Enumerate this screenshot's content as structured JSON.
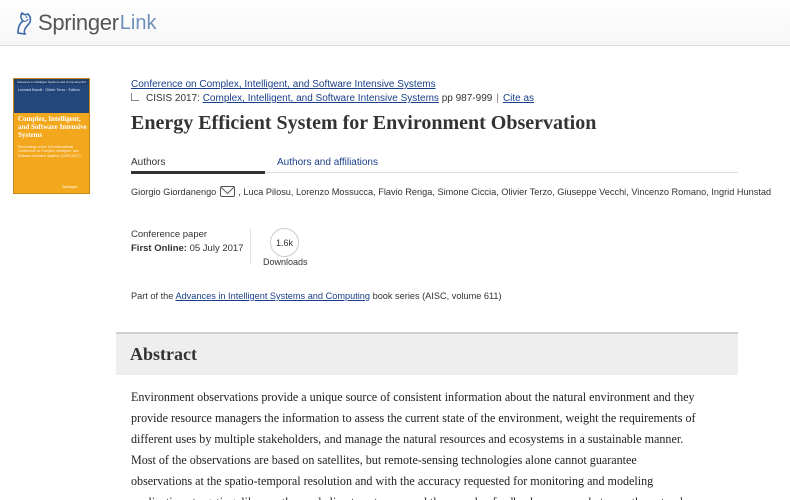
{
  "header": {
    "logo_springer": "Springer",
    "logo_link": "Link"
  },
  "cover": {
    "series": "Advances in Intelligent Systems and Computing 611",
    "editors": "Leonard Barolli · Olivier Terzo · Editors",
    "title": "Complex, Intelligent, and Software Intensive Systems",
    "subtitle": "Proceedings of the 11th International Conference on Complex, Intelligent, and Software Intensive Systems (CISIS-2017)",
    "publisher": "Springer"
  },
  "breadcrumb": {
    "conference": "Conference on Complex, Intelligent, and Software Intensive Systems",
    "proceedings_prefix": "CISIS 2017:",
    "proceedings_link": "Complex, Intelligent, and Software Intensive Systems",
    "pages": "pp 987-999",
    "separator": "|",
    "cite_as": "Cite as"
  },
  "paper": {
    "title": "Energy Efficient System for Environment Observation"
  },
  "tabs": {
    "authors": "Authors",
    "affiliations": "Authors and affiliations"
  },
  "authors": {
    "first": "Giorgio Giordanengo",
    "rest": ", Luca Pilosu, Lorenzo Mossucca, Flavio Renga, Simone Ciccia, Olivier Terzo, Giuseppe Vecchi, Vincenzo Romano, Ingrid Hunstad"
  },
  "meta": {
    "type": "Conference paper",
    "first_online_label": "First Online:",
    "first_online_date": "05 July 2017",
    "downloads_count": "1.6k",
    "downloads_label": "Downloads"
  },
  "series": {
    "prefix": "Part of the",
    "link": "Advances in Intelligent Systems and Computing",
    "suffix": "book series (AISC, volume 611)"
  },
  "abstract": {
    "heading": "Abstract",
    "lines": [
      "Environment observations provide a unique source of consistent information about the natural environment and they",
      "provide resource managers the information to assess the current state of the environment, weight the requirements of",
      "different uses by multiple stakeholders, and manage the natural resources and ecosystems in a sustainable manner.",
      "Most of the observations are based on satellites, but remote-sensing technologies alone cannot guarantee",
      "observations at the spatio-temporal resolution and with the accuracy requested for monitoring and modeling",
      "applications targeting, like weather and climate extremes and the complex feedback processes between the natural"
    ]
  }
}
